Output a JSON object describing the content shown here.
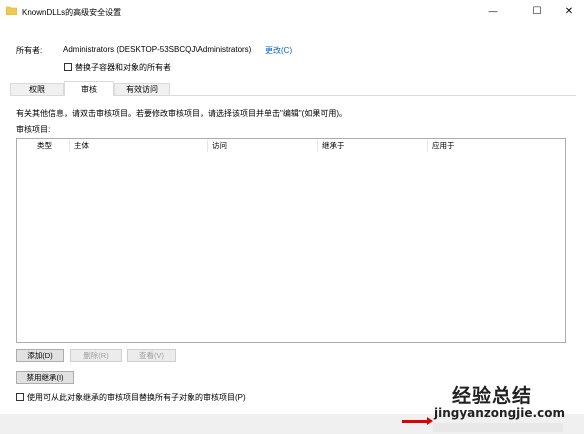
{
  "window": {
    "title": "KnownDLLs的高级安全设置",
    "minimize_glyph": "—",
    "maximize_glyph": "☐",
    "close_glyph": "✕"
  },
  "owner": {
    "label": "所有者:",
    "value": "Administrators (DESKTOP-53SBCQJ\\Administrators)",
    "change_link": "更改(C)",
    "replace_checkbox_label": "替换子容器和对象的所有者",
    "replace_checked": false
  },
  "tabs": [
    {
      "label": "权限",
      "active": false
    },
    {
      "label": "审核",
      "active": true
    },
    {
      "label": "有效访问",
      "active": false
    }
  ],
  "audit": {
    "info_text": "有关其他信息，请双击审核项目。若要修改审核项目，请选择该项目并单击\"编辑\"(如果可用)。",
    "list_label": "审核项目:",
    "columns": [
      "类型",
      "主体",
      "访问",
      "继承于",
      "应用于"
    ],
    "rows": []
  },
  "buttons": {
    "add": "添加(D)",
    "remove": "删除(R)",
    "view": "查看(V)",
    "disable_inheritance": "禁用继承(I)"
  },
  "replace_child_audit": {
    "label": "使用可从此对象继承的审核项目替换所有子对象的审核项目(P)",
    "checked": false
  },
  "watermark": {
    "title": "经验总结",
    "url": "jingyanzongjie.com"
  },
  "colors": {
    "link": "#0066cc",
    "folder": "#f2c94c",
    "arrow": "#dd0000"
  }
}
